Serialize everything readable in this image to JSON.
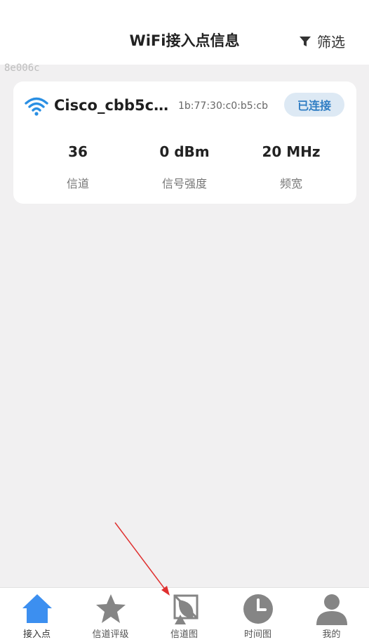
{
  "header": {
    "title": "WiFi接入点信息",
    "filter_label": "筛选"
  },
  "debug_text": "8e006c",
  "access_point": {
    "ssid": "Cisco_cbb5c0...",
    "bssid": "1b:77:30:c0:b5:cb",
    "status": "已连接",
    "stats": [
      {
        "value": "36",
        "label": "信道"
      },
      {
        "value": "0 dBm",
        "label": "信号强度"
      },
      {
        "value": "20 MHz",
        "label": "频宽"
      }
    ]
  },
  "tabs": [
    {
      "label": "接入点",
      "icon": "home-icon"
    },
    {
      "label": "信道评级",
      "icon": "star-icon"
    },
    {
      "label": "信道图",
      "icon": "satellite-dish-icon"
    },
    {
      "label": "时间图",
      "icon": "clock-icon"
    },
    {
      "label": "我的",
      "icon": "user-icon"
    }
  ],
  "colors": {
    "accent": "#2f7dc3",
    "wifi": "#2a8fe3",
    "home_active": "#3c8ff0",
    "tab_inactive": "#858585",
    "annotation_arrow": "#e03030"
  }
}
